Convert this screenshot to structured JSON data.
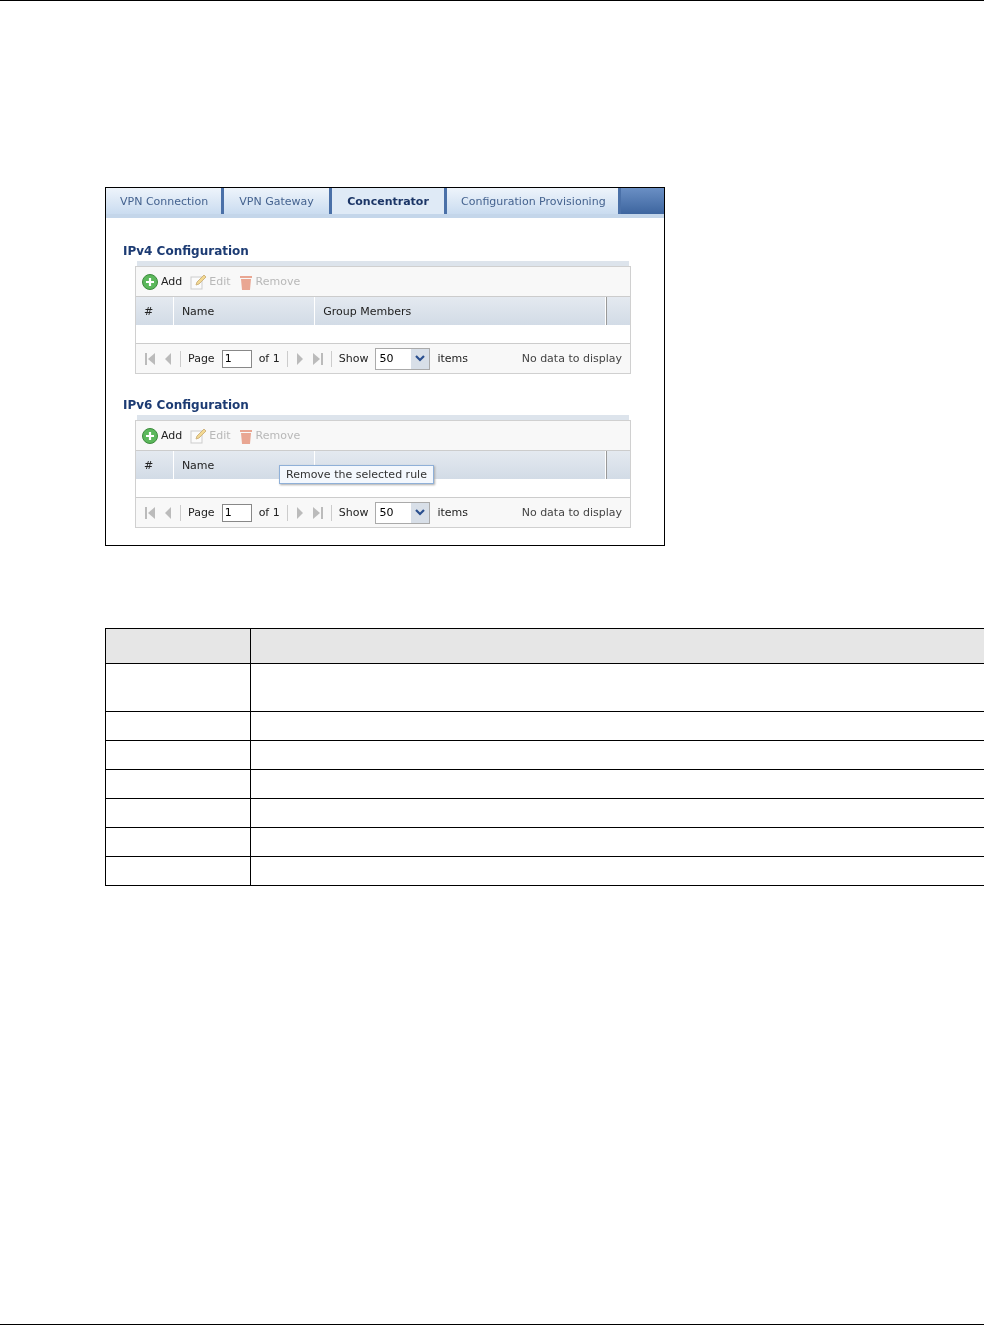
{
  "tabs": [
    {
      "label": "VPN Connection",
      "selected": false
    },
    {
      "label": "VPN Gateway",
      "selected": false
    },
    {
      "label": "Concentrator",
      "selected": true
    },
    {
      "label": "Configuration Provisioning",
      "selected": false
    }
  ],
  "sections": [
    {
      "title": "IPv4 Configuration",
      "toolbar": [
        {
          "kind": "add",
          "label": "Add",
          "disabled": false
        },
        {
          "kind": "edit",
          "label": "Edit",
          "disabled": true
        },
        {
          "kind": "remove",
          "label": "Remove",
          "disabled": true
        }
      ],
      "columns": [
        "#",
        "Name",
        "Group Members",
        ""
      ],
      "pager": {
        "page_label": "Page",
        "page": "1",
        "of": "of 1",
        "show_label": "Show",
        "per_page": "50",
        "items_label": "items",
        "status": "No data to display"
      }
    },
    {
      "title": "IPv6 Configuration",
      "toolbar": [
        {
          "kind": "add",
          "label": "Add",
          "disabled": false
        },
        {
          "kind": "edit",
          "label": "Edit",
          "disabled": true
        },
        {
          "kind": "remove",
          "label": "Remove",
          "disabled": true
        }
      ],
      "columns": [
        "#",
        "Name",
        "",
        ""
      ],
      "tooltip": "Remove the selected rule",
      "pager": {
        "page_label": "Page",
        "page": "1",
        "of": "of 1",
        "show_label": "Show",
        "per_page": "50",
        "items_label": "items",
        "status": "No data to display"
      }
    }
  ]
}
